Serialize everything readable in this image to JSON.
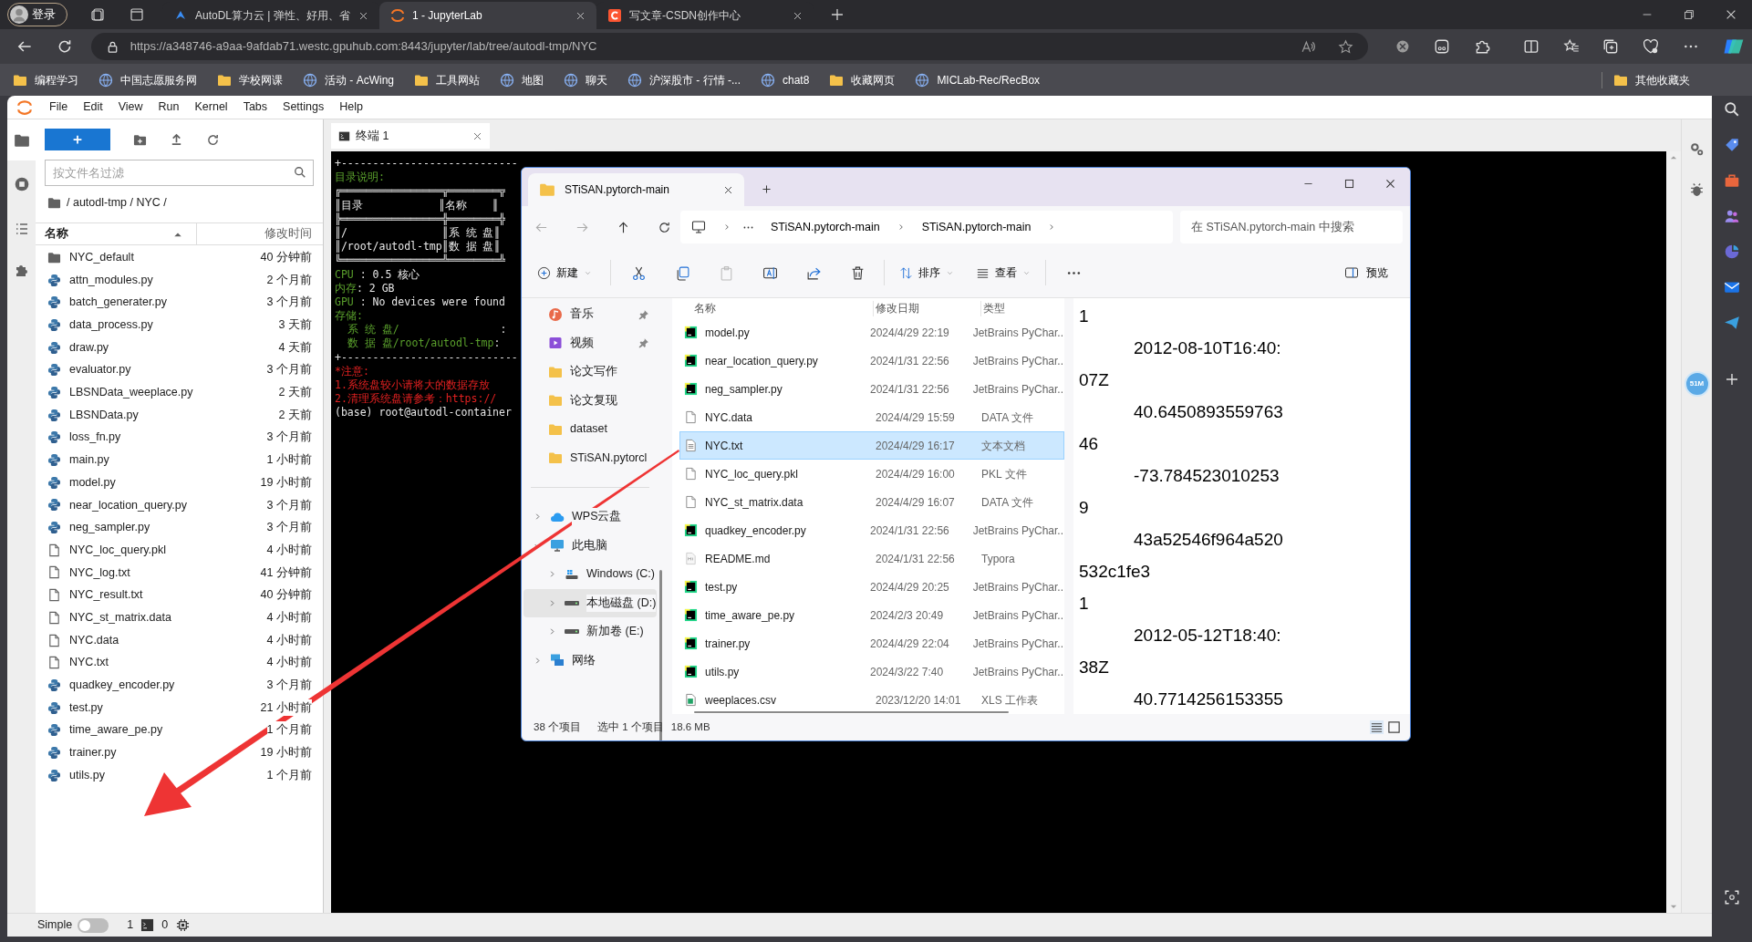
{
  "browser": {
    "profile_button": "登录",
    "tabs": [
      {
        "title": "AutoDL算力云 | 弹性、好用、省",
        "kind": "autodl",
        "selected": false
      },
      {
        "title": "1 - JupyterLab",
        "kind": "jupyter",
        "selected": true
      },
      {
        "title": "写文章-CSDN创作中心",
        "kind": "csdn",
        "selected": false
      }
    ],
    "address": "https://a348746-a9aa-9afdab71.westc.gpuhub.com:8443/jupyter/lab/tree/autodl-tmp/NYC",
    "bookmarks": [
      {
        "label": "编程学习",
        "kind": "folder"
      },
      {
        "label": "中国志愿服务网",
        "kind": "site"
      },
      {
        "label": "学校网课",
        "kind": "folder"
      },
      {
        "label": "活动 - AcWing",
        "kind": "site"
      },
      {
        "label": "工具网站",
        "kind": "folder"
      },
      {
        "label": "地图",
        "kind": "site"
      },
      {
        "label": "聊天",
        "kind": "site"
      },
      {
        "label": "沪深股市 - 行情 -...",
        "kind": "site"
      },
      {
        "label": "chat8",
        "kind": "site"
      },
      {
        "label": "收藏网页",
        "kind": "folder"
      },
      {
        "label": "MICLab-Rec/RecBox",
        "kind": "site"
      }
    ],
    "other_bookmarks": "其他收藏夹"
  },
  "jupyter": {
    "menu": [
      "File",
      "Edit",
      "View",
      "Run",
      "Kernel",
      "Tabs",
      "Settings",
      "Help"
    ],
    "file_browser": {
      "filter_placeholder": "按文件名过滤",
      "breadcrumb": "/ autodl-tmp / NYC /",
      "columns": [
        "名称",
        "修改时间"
      ],
      "files": [
        {
          "name": "NYC_default",
          "modified": "40 分钟前",
          "kind": "folder"
        },
        {
          "name": "attn_modules.py",
          "modified": "2 个月前",
          "kind": "python"
        },
        {
          "name": "batch_generater.py",
          "modified": "3 个月前",
          "kind": "python"
        },
        {
          "name": "data_process.py",
          "modified": "3 天前",
          "kind": "python"
        },
        {
          "name": "draw.py",
          "modified": "4 天前",
          "kind": "python"
        },
        {
          "name": "evaluator.py",
          "modified": "3 个月前",
          "kind": "python"
        },
        {
          "name": "LBSNData_weeplace.py",
          "modified": "2 天前",
          "kind": "python"
        },
        {
          "name": "LBSNData.py",
          "modified": "2 天前",
          "kind": "python"
        },
        {
          "name": "loss_fn.py",
          "modified": "3 个月前",
          "kind": "python"
        },
        {
          "name": "main.py",
          "modified": "1 小时前",
          "kind": "python"
        },
        {
          "name": "model.py",
          "modified": "19 小时前",
          "kind": "python"
        },
        {
          "name": "near_location_query.py",
          "modified": "3 个月前",
          "kind": "python"
        },
        {
          "name": "neg_sampler.py",
          "modified": "3 个月前",
          "kind": "python"
        },
        {
          "name": "NYC_loc_query.pkl",
          "modified": "4 小时前",
          "kind": "file"
        },
        {
          "name": "NYC_log.txt",
          "modified": "41 分钟前",
          "kind": "file"
        },
        {
          "name": "NYC_result.txt",
          "modified": "40 分钟前",
          "kind": "file"
        },
        {
          "name": "NYC_st_matrix.data",
          "modified": "4 小时前",
          "kind": "file"
        },
        {
          "name": "NYC.data",
          "modified": "4 小时前",
          "kind": "file"
        },
        {
          "name": "NYC.txt",
          "modified": "4 小时前",
          "kind": "file"
        },
        {
          "name": "quadkey_encoder.py",
          "modified": "3 个月前",
          "kind": "python"
        },
        {
          "name": "test.py",
          "modified": "21 小时前",
          "kind": "python"
        },
        {
          "name": "time_aware_pe.py",
          "modified": "1 个月前",
          "kind": "python"
        },
        {
          "name": "trainer.py",
          "modified": "19 小时前",
          "kind": "python"
        },
        {
          "name": "utils.py",
          "modified": "1 个月前",
          "kind": "python"
        }
      ]
    },
    "terminal_tab": "终端 1",
    "terminal_lines": [
      [
        {
          "text": "+----------------------------",
          "kind": "plain"
        }
      ],
      [
        {
          "text": "目录说明:",
          "kind": "label"
        }
      ],
      [
        {
          "text": "╔════════════════╦════════╦",
          "kind": "plain"
        }
      ],
      [
        {
          "text": "║目录            ║名称    ║",
          "kind": "plain"
        }
      ],
      [
        {
          "text": "╠════════════════╬════════╬",
          "kind": "plain"
        }
      ],
      [
        {
          "text": "║/               ║系 统 盘║",
          "kind": "plain"
        }
      ],
      [
        {
          "text": "║/root/autodl-tmp║数 据 盘║",
          "kind": "plain"
        }
      ],
      [
        {
          "text": "╚════════════════╩════════╩",
          "kind": "plain"
        }
      ],
      [
        {
          "text": "CPU",
          "kind": "label"
        },
        {
          "text": " : 0.5 核心",
          "kind": "plain"
        }
      ],
      [
        {
          "text": "内存",
          "kind": "label"
        },
        {
          "text": ": 2 GB",
          "kind": "plain"
        }
      ],
      [
        {
          "text": "GPU",
          "kind": "label"
        },
        {
          "text": " : No devices were found",
          "kind": "plain"
        }
      ],
      [
        {
          "text": "存储:",
          "kind": "label"
        }
      ],
      [
        {
          "text": "  系 统 盘/",
          "kind": "label"
        },
        {
          "text": "                :",
          "kind": "plain"
        }
      ],
      [
        {
          "text": "  数 据 盘/root/autodl-tmp",
          "kind": "label"
        },
        {
          "text": ":",
          "kind": "plain"
        }
      ],
      [
        {
          "text": "+----------------------------",
          "kind": "plain"
        }
      ],
      [
        {
          "text": "*注意:",
          "kind": "warning"
        }
      ],
      [
        {
          "text": "1.系统盘较小请将大的数据存放",
          "kind": "warning"
        }
      ],
      [
        {
          "text": "2.清理系统盘请参考：https://",
          "kind": "warning"
        }
      ],
      [
        {
          "text": "(base) root@autodl-container",
          "kind": "plain"
        }
      ]
    ],
    "side_badge": "51M",
    "status_bar": {
      "mode_label": "Simple",
      "simple_mode": false,
      "terminals": "1",
      "kernels": "0"
    }
  },
  "explorer": {
    "tab_title": "STiSAN.pytorch-main",
    "breadcrumb": [
      "STiSAN.pytorch-main",
      "STiSAN.pytorch-main"
    ],
    "search_placeholder": "在 STiSAN.pytorch-main 中搜索",
    "toolbar": {
      "new": "新建",
      "sort": "排序",
      "view": "查看",
      "preview": "预览"
    },
    "quick_access": [
      {
        "label": "音乐",
        "kind": "music",
        "pinned": true
      },
      {
        "label": "视频",
        "kind": "video",
        "pinned": true
      },
      {
        "label": "论文写作",
        "kind": "folder",
        "pinned": false
      },
      {
        "label": "论文复现",
        "kind": "folder",
        "pinned": false
      },
      {
        "label": "dataset",
        "kind": "folder",
        "pinned": false
      },
      {
        "label": "STiSAN.pytorcl",
        "kind": "folder",
        "pinned": false
      }
    ],
    "tree": [
      {
        "label": "WPS云盘",
        "kind": "cloud",
        "expanded": false,
        "selected": false
      },
      {
        "label": "此电脑",
        "kind": "pc",
        "expanded": true,
        "selected": false,
        "children": [
          {
            "label": "Windows (C:)",
            "kind": "system-drive",
            "expanded": false,
            "selected": false
          },
          {
            "label": "本地磁盘 (D:)",
            "kind": "drive",
            "expanded": false,
            "selected": true
          },
          {
            "label": "新加卷 (E:)",
            "kind": "drive",
            "expanded": false,
            "selected": false
          }
        ]
      },
      {
        "label": "网络",
        "kind": "network",
        "expanded": false,
        "selected": false
      }
    ],
    "columns": [
      "名称",
      "修改日期",
      "类型"
    ],
    "files": [
      {
        "name": "model.py",
        "date": "2024/4/29 22:19",
        "type": "JetBrains PyChar..",
        "kind": "code",
        "selected": false
      },
      {
        "name": "near_location_query.py",
        "date": "2024/1/31 22:56",
        "type": "JetBrains PyChar..",
        "kind": "code",
        "selected": false
      },
      {
        "name": "neg_sampler.py",
        "date": "2024/1/31 22:56",
        "type": "JetBrains PyChar..",
        "kind": "code",
        "selected": false
      },
      {
        "name": "NYC.data",
        "date": "2024/4/29 15:59",
        "type": "DATA 文件",
        "kind": "blank",
        "selected": false
      },
      {
        "name": "NYC.txt",
        "date": "2024/4/29 16:17",
        "type": "文本文档",
        "kind": "text",
        "selected": true
      },
      {
        "name": "NYC_loc_query.pkl",
        "date": "2024/4/29 16:00",
        "type": "PKL 文件",
        "kind": "blank",
        "selected": false
      },
      {
        "name": "NYC_st_matrix.data",
        "date": "2024/4/29 16:07",
        "type": "DATA 文件",
        "kind": "blank",
        "selected": false
      },
      {
        "name": "quadkey_encoder.py",
        "date": "2024/1/31 22:56",
        "type": "JetBrains PyChar..",
        "kind": "code",
        "selected": false
      },
      {
        "name": "README.md",
        "date": "2024/1/31 22:56",
        "type": "Typora",
        "kind": "markdown",
        "selected": false
      },
      {
        "name": "test.py",
        "date": "2024/4/29 20:25",
        "type": "JetBrains PyChar..",
        "kind": "code",
        "selected": false
      },
      {
        "name": "time_aware_pe.py",
        "date": "2024/2/3 20:49",
        "type": "JetBrains PyChar..",
        "kind": "code",
        "selected": false
      },
      {
        "name": "trainer.py",
        "date": "2024/4/29 22:04",
        "type": "JetBrains PyChar..",
        "kind": "code",
        "selected": false
      },
      {
        "name": "utils.py",
        "date": "2024/3/22 7:40",
        "type": "JetBrains PyChar..",
        "kind": "code",
        "selected": false
      },
      {
        "name": "weeplaces.csv",
        "date": "2023/12/20 14:01",
        "type": "XLS 工作表",
        "kind": "sheet",
        "selected": false
      }
    ],
    "preview_lines": [
      {
        "text": "1",
        "kind": "wrap"
      },
      {
        "text": "2012-08-10T16:40:",
        "kind": "field"
      },
      {
        "text": "07Z",
        "kind": "wrap"
      },
      {
        "text": "40.6450893559763",
        "kind": "field"
      },
      {
        "text": "46",
        "kind": "wrap"
      },
      {
        "text": "-73.784523010253",
        "kind": "field"
      },
      {
        "text": "9",
        "kind": "wrap"
      },
      {
        "text": "43a52546f964a520",
        "kind": "field"
      },
      {
        "text": "532c1fe3",
        "kind": "wrap"
      },
      {
        "text": "1",
        "kind": "wrap"
      },
      {
        "text": "2012-05-12T18:40:",
        "kind": "field"
      },
      {
        "text": "38Z",
        "kind": "wrap"
      },
      {
        "text": "40.7714256153355",
        "kind": "field"
      }
    ],
    "status": {
      "count": "38 个项目",
      "selection": "选中 1 个项目",
      "size": "18.6 MB"
    }
  }
}
